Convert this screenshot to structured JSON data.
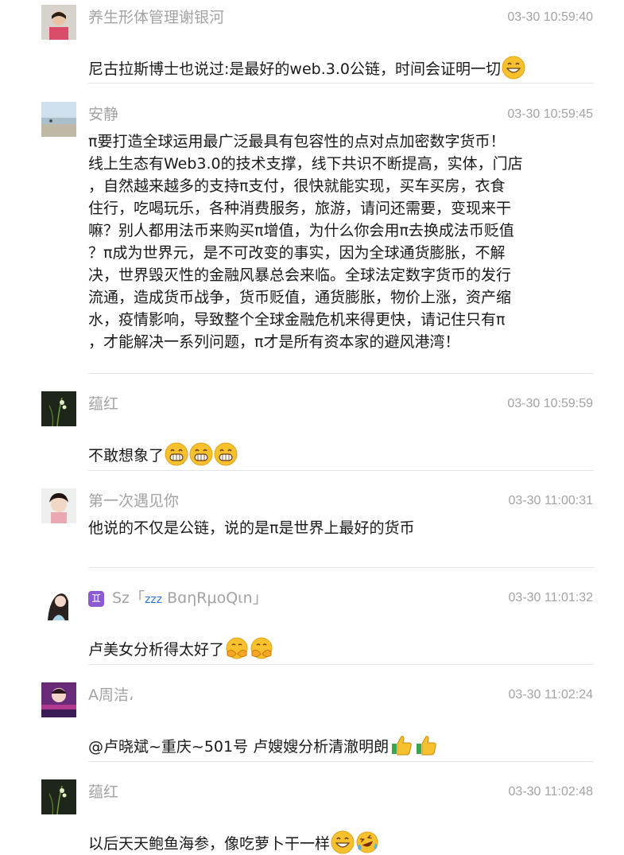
{
  "comments": [
    {
      "name": "养生形体管理谢银河",
      "time": "03-30 10:59:40",
      "text": "尼古拉斯博士也说过:是最好的web.3.0公链，时间会证明一切"
    },
    {
      "name": "安静",
      "time": "03-30 10:59:45",
      "text": "π要打造全球运用最广泛最具有包容性的点对点加密数字货币！\n线上生态有Web3.0的技术支撑，线下共识不断提高，实体，门店\n，自然越来越多的支持π支付，很快就能实现，买车买房，衣食\n住行，吃喝玩乐，各种消费服务，旅游，请问还需要，变现来干\n嘛？别人都用法币来购买π增值，为什么你会用π去换成法币贬值\n？π成为世界元，是不可改变的事实，因为全球通货膨胀，不解\n决，世界毁灭性的金融风暴总会来临。全球法定数字货币的发行\n流通，造成货币战争，货币贬值，通货膨胀，物价上涨，资产缩\n水，疫情影响，导致整个全球金融危机来得更快，请记住只有π\n，才能解决一系列问题，π才是所有资本家的避风港湾！"
    },
    {
      "name": "蕴红",
      "time": "03-30 10:59:59",
      "text": "不敢想象了"
    },
    {
      "name": "第一次遇见你",
      "time": "03-30 11:00:31",
      "text": "他说的不仅是公链，说的是π是世界上最好的货币"
    },
    {
      "name_prefix": "♊",
      "name_mid": "Sz「",
      "name_zzz": "zzz",
      "name_suffix": "BɑηRμoQιn」",
      "time": "03-30 11:01:32",
      "text": "卢美女分析得太好了"
    },
    {
      "name": "A周洁،",
      "time": "03-30 11:02:24",
      "text": "@卢晓斌~重庆~501号 卢嫂嫂分析清澈明朗"
    },
    {
      "name": "蕴红",
      "time": "03-30 11:02:48",
      "text": "以后天天鲍鱼海参，像吃萝卜干一样"
    }
  ],
  "colors": {
    "name": "#a3a3a3",
    "text": "#191919",
    "divider": "#e3e3e3",
    "emoji": "#f7c12e"
  }
}
